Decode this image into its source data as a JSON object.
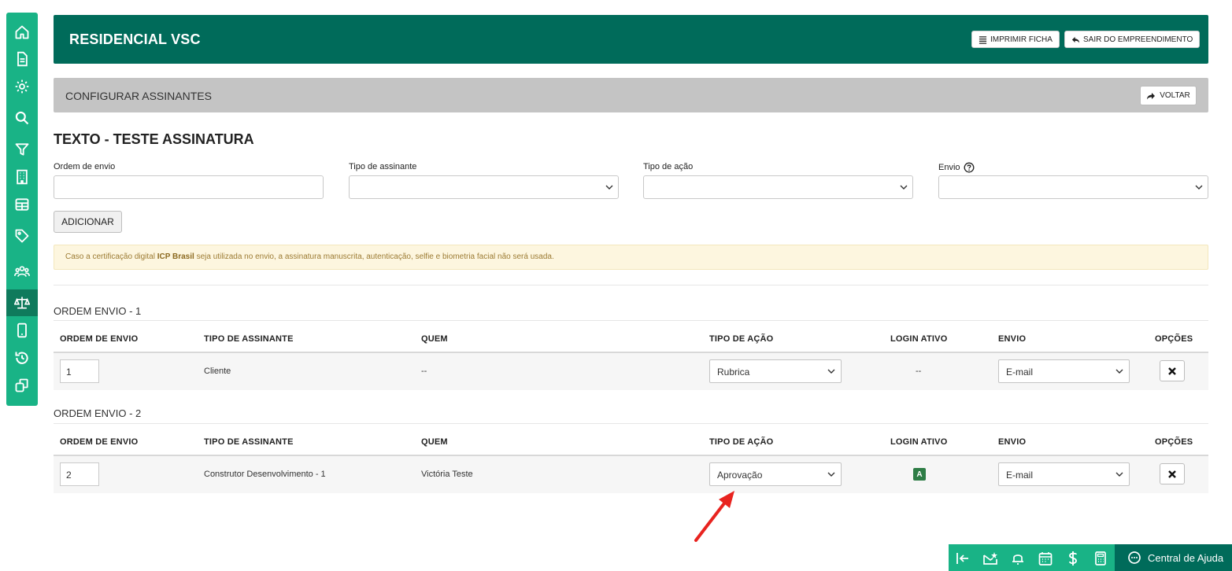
{
  "sidebar": {
    "icons": [
      "home-icon",
      "document-icon",
      "gear-icon",
      "search-icon",
      "filter-icon",
      "building-icon",
      "table-icon",
      "tag-icon",
      "users-icon",
      "scale-icon",
      "mobile-icon",
      "history-icon",
      "copy-icon"
    ],
    "active_index": 9
  },
  "header": {
    "title": "RESIDENCIAL VSC",
    "print_label": "IMPRIMIR FICHA",
    "exit_label": "SAIR DO EMPREENDIMENTO"
  },
  "config": {
    "title": "CONFIGURAR ASSINANTES",
    "back_label": "VOLTAR"
  },
  "section_title": "TEXTO - TESTE ASSINATURA",
  "form": {
    "order_label": "Ordem de envio",
    "signer_type_label": "Tipo de assinante",
    "action_type_label": "Tipo de ação",
    "send_label": "Envio",
    "add_label": "ADICIONAR"
  },
  "alert": {
    "prefix": "Caso a certificação digital ",
    "bold": "ICP Brasil",
    "suffix": " seja utilizada no envio, a assinatura manuscrita, autenticação, selfie e biometria facial não será usada."
  },
  "columns": [
    "ORDEM DE ENVIO",
    "TIPO DE ASSINANTE",
    "QUEM",
    "TIPO DE AÇÃO",
    "LOGIN ATIVO",
    "ENVIO",
    "OPÇÕES"
  ],
  "groups": [
    {
      "title": "ORDEM ENVIO - 1",
      "row": {
        "order": "1",
        "signer_type": "Cliente",
        "who": "--",
        "action": "Rubrica",
        "login": "--",
        "send": "E-mail"
      }
    },
    {
      "title": "ORDEM ENVIO - 2",
      "row": {
        "order": "2",
        "signer_type": "Construtor Desenvolvimento - 1",
        "who": "Victória Teste",
        "action": "Aprovação",
        "login": "A",
        "send": "E-mail"
      }
    }
  ],
  "bottom_bar": {
    "icons": [
      "collapse-icon",
      "mail-star-icon",
      "bell-icon",
      "calendar-icon",
      "dollar-icon",
      "calculator-icon"
    ],
    "help_label": "Central de Ajuda"
  },
  "colors": {
    "brand_dark": "#006b5a",
    "brand_light": "#19b386",
    "alert_bg": "#fdf6df",
    "arrow": "#e8231f"
  }
}
